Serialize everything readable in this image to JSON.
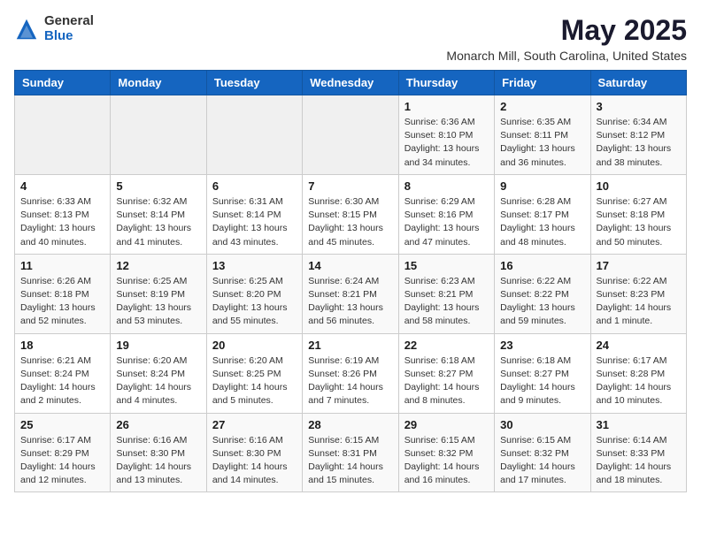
{
  "logo": {
    "general": "General",
    "blue": "Blue"
  },
  "title": "May 2025",
  "location": "Monarch Mill, South Carolina, United States",
  "days_of_week": [
    "Sunday",
    "Monday",
    "Tuesday",
    "Wednesday",
    "Thursday",
    "Friday",
    "Saturday"
  ],
  "weeks": [
    [
      {
        "day": "",
        "info": ""
      },
      {
        "day": "",
        "info": ""
      },
      {
        "day": "",
        "info": ""
      },
      {
        "day": "",
        "info": ""
      },
      {
        "day": "1",
        "info": "Sunrise: 6:36 AM\nSunset: 8:10 PM\nDaylight: 13 hours\nand 34 minutes."
      },
      {
        "day": "2",
        "info": "Sunrise: 6:35 AM\nSunset: 8:11 PM\nDaylight: 13 hours\nand 36 minutes."
      },
      {
        "day": "3",
        "info": "Sunrise: 6:34 AM\nSunset: 8:12 PM\nDaylight: 13 hours\nand 38 minutes."
      }
    ],
    [
      {
        "day": "4",
        "info": "Sunrise: 6:33 AM\nSunset: 8:13 PM\nDaylight: 13 hours\nand 40 minutes."
      },
      {
        "day": "5",
        "info": "Sunrise: 6:32 AM\nSunset: 8:14 PM\nDaylight: 13 hours\nand 41 minutes."
      },
      {
        "day": "6",
        "info": "Sunrise: 6:31 AM\nSunset: 8:14 PM\nDaylight: 13 hours\nand 43 minutes."
      },
      {
        "day": "7",
        "info": "Sunrise: 6:30 AM\nSunset: 8:15 PM\nDaylight: 13 hours\nand 45 minutes."
      },
      {
        "day": "8",
        "info": "Sunrise: 6:29 AM\nSunset: 8:16 PM\nDaylight: 13 hours\nand 47 minutes."
      },
      {
        "day": "9",
        "info": "Sunrise: 6:28 AM\nSunset: 8:17 PM\nDaylight: 13 hours\nand 48 minutes."
      },
      {
        "day": "10",
        "info": "Sunrise: 6:27 AM\nSunset: 8:18 PM\nDaylight: 13 hours\nand 50 minutes."
      }
    ],
    [
      {
        "day": "11",
        "info": "Sunrise: 6:26 AM\nSunset: 8:18 PM\nDaylight: 13 hours\nand 52 minutes."
      },
      {
        "day": "12",
        "info": "Sunrise: 6:25 AM\nSunset: 8:19 PM\nDaylight: 13 hours\nand 53 minutes."
      },
      {
        "day": "13",
        "info": "Sunrise: 6:25 AM\nSunset: 8:20 PM\nDaylight: 13 hours\nand 55 minutes."
      },
      {
        "day": "14",
        "info": "Sunrise: 6:24 AM\nSunset: 8:21 PM\nDaylight: 13 hours\nand 56 minutes."
      },
      {
        "day": "15",
        "info": "Sunrise: 6:23 AM\nSunset: 8:21 PM\nDaylight: 13 hours\nand 58 minutes."
      },
      {
        "day": "16",
        "info": "Sunrise: 6:22 AM\nSunset: 8:22 PM\nDaylight: 13 hours\nand 59 minutes."
      },
      {
        "day": "17",
        "info": "Sunrise: 6:22 AM\nSunset: 8:23 PM\nDaylight: 14 hours\nand 1 minute."
      }
    ],
    [
      {
        "day": "18",
        "info": "Sunrise: 6:21 AM\nSunset: 8:24 PM\nDaylight: 14 hours\nand 2 minutes."
      },
      {
        "day": "19",
        "info": "Sunrise: 6:20 AM\nSunset: 8:24 PM\nDaylight: 14 hours\nand 4 minutes."
      },
      {
        "day": "20",
        "info": "Sunrise: 6:20 AM\nSunset: 8:25 PM\nDaylight: 14 hours\nand 5 minutes."
      },
      {
        "day": "21",
        "info": "Sunrise: 6:19 AM\nSunset: 8:26 PM\nDaylight: 14 hours\nand 7 minutes."
      },
      {
        "day": "22",
        "info": "Sunrise: 6:18 AM\nSunset: 8:27 PM\nDaylight: 14 hours\nand 8 minutes."
      },
      {
        "day": "23",
        "info": "Sunrise: 6:18 AM\nSunset: 8:27 PM\nDaylight: 14 hours\nand 9 minutes."
      },
      {
        "day": "24",
        "info": "Sunrise: 6:17 AM\nSunset: 8:28 PM\nDaylight: 14 hours\nand 10 minutes."
      }
    ],
    [
      {
        "day": "25",
        "info": "Sunrise: 6:17 AM\nSunset: 8:29 PM\nDaylight: 14 hours\nand 12 minutes."
      },
      {
        "day": "26",
        "info": "Sunrise: 6:16 AM\nSunset: 8:30 PM\nDaylight: 14 hours\nand 13 minutes."
      },
      {
        "day": "27",
        "info": "Sunrise: 6:16 AM\nSunset: 8:30 PM\nDaylight: 14 hours\nand 14 minutes."
      },
      {
        "day": "28",
        "info": "Sunrise: 6:15 AM\nSunset: 8:31 PM\nDaylight: 14 hours\nand 15 minutes."
      },
      {
        "day": "29",
        "info": "Sunrise: 6:15 AM\nSunset: 8:32 PM\nDaylight: 14 hours\nand 16 minutes."
      },
      {
        "day": "30",
        "info": "Sunrise: 6:15 AM\nSunset: 8:32 PM\nDaylight: 14 hours\nand 17 minutes."
      },
      {
        "day": "31",
        "info": "Sunrise: 6:14 AM\nSunset: 8:33 PM\nDaylight: 14 hours\nand 18 minutes."
      }
    ]
  ]
}
